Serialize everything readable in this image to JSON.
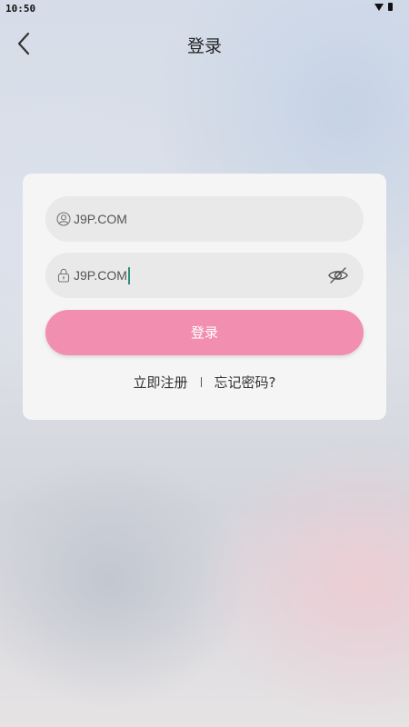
{
  "status_bar": {
    "time": "10:50"
  },
  "header": {
    "title": "登录"
  },
  "login_form": {
    "username_value": "J9P.COM",
    "password_value": "J9P.COM",
    "login_label": "登录",
    "register_label": "立即注册",
    "forgot_label": "忘记密码?"
  },
  "icons": {
    "back": "chevron-left-icon",
    "user": "user-circle-icon",
    "lock": "lock-icon",
    "eye": "eye-off-icon",
    "wifi": "wifi-icon",
    "battery": "battery-icon"
  },
  "colors": {
    "accent": "#f28fb1",
    "caret": "#2f8f7d",
    "card": "#f6f6f6",
    "field": "#e9e9e9"
  }
}
